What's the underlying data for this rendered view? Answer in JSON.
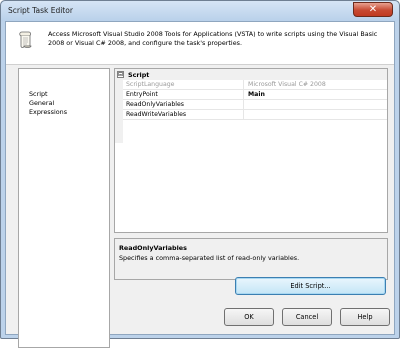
{
  "window": {
    "title": "Script Task Editor",
    "close_glyph": "✕"
  },
  "header": {
    "icon": "script-scroll-icon",
    "description": "Access Microsoft Visual Studio 2008 Tools for Applications (VSTA) to write scripts using the Visual Basic 2008 or Visual C# 2008, and configure the task's properties."
  },
  "nav": {
    "items": [
      {
        "label": "Script",
        "selected": true
      },
      {
        "label": "General",
        "selected": false
      },
      {
        "label": "Expressions",
        "selected": false
      }
    ]
  },
  "property_grid": {
    "category": {
      "label": "Script",
      "expander": "⊟"
    },
    "rows": [
      {
        "name": "ScriptLanguage",
        "value": "Microsoft Visual C# 2008",
        "disabled": true,
        "bold": false
      },
      {
        "name": "EntryPoint",
        "value": "Main",
        "disabled": false,
        "bold": true
      },
      {
        "name": "ReadOnlyVariables",
        "value": "",
        "disabled": false,
        "bold": false
      },
      {
        "name": "ReadWriteVariables",
        "value": "",
        "disabled": false,
        "bold": false
      }
    ]
  },
  "description_panel": {
    "title": "ReadOnlyVariables",
    "text": "Specifies a comma-separated list of read-only variables."
  },
  "buttons": {
    "edit_script": "Edit Script...",
    "ok": "OK",
    "cancel": "Cancel",
    "help": "Help"
  },
  "colors": {
    "window_frame": "#bcd2ea",
    "client_bg": "#f0f0f0",
    "edit_button_accent": "#3c7fb1",
    "close_button": "#c74a33"
  }
}
